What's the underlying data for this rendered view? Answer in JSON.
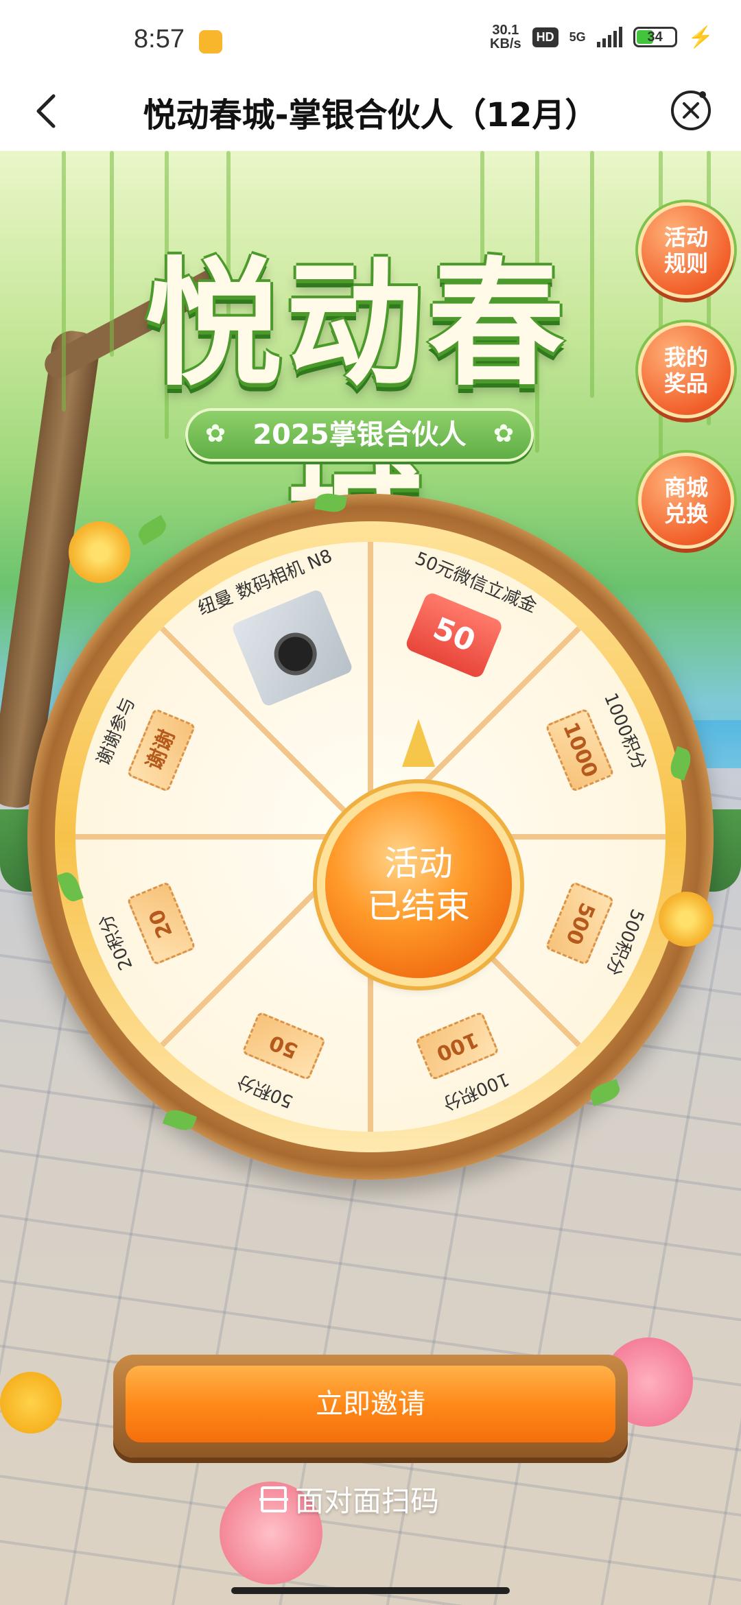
{
  "status_bar": {
    "time": "8:57",
    "net_speed_value": "30.1",
    "net_speed_unit": "KB/s",
    "hd": "HD",
    "network": "5G",
    "battery": "34"
  },
  "nav": {
    "title": "悦动春城-掌银合伙人（12月）",
    "back_icon": "chevron-left-icon",
    "close_icon": "close-circle-icon"
  },
  "hero": {
    "title": "悦动春城",
    "subtitle": "2025掌银合伙人"
  },
  "side_buttons": [
    {
      "label_line1": "活动",
      "label_line2": "规则"
    },
    {
      "label_line1": "我的",
      "label_line2": "奖品"
    },
    {
      "label_line1": "商城",
      "label_line2": "兑换"
    }
  ],
  "wheel": {
    "center_line1": "活动",
    "center_line2": "已结束",
    "prizes": [
      {
        "label": "50元微信立减金",
        "badge": "50"
      },
      {
        "label": "1000积分",
        "badge": "1000"
      },
      {
        "label": "500积分",
        "badge": "500"
      },
      {
        "label": "100积分",
        "badge": "100"
      },
      {
        "label": "50积分",
        "badge": "50"
      },
      {
        "label": "20积分",
        "badge": "20"
      },
      {
        "label": "谢谢参与",
        "badge": "谢谢"
      },
      {
        "label": "纽曼 数码相机 N8",
        "badge": ""
      }
    ]
  },
  "actions": {
    "invite": "立即邀请",
    "scan": "面对面扫码"
  }
}
